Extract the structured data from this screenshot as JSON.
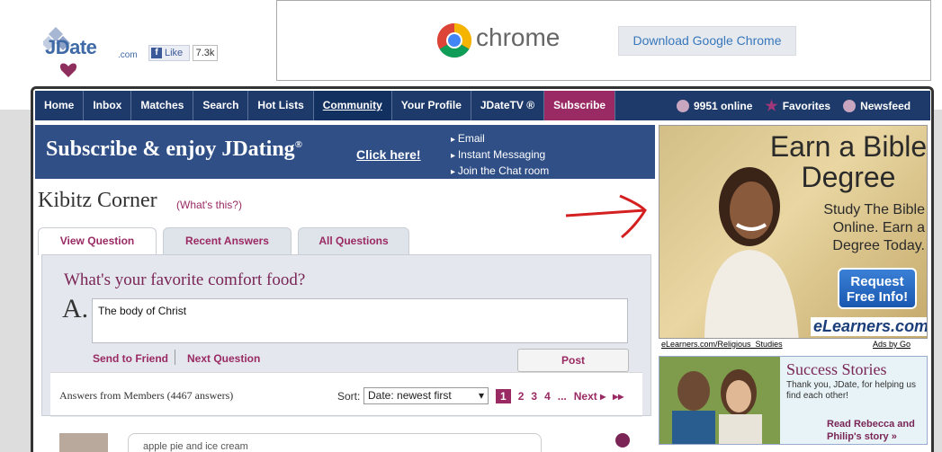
{
  "header": {
    "logo_text": "JDate",
    "logo_suffix": ".com",
    "fb_like_label": "Like",
    "fb_like_count": "7.3k"
  },
  "chrome_ad": {
    "word": "chrome",
    "button_label": "Download Google Chrome"
  },
  "nav": {
    "items": [
      {
        "label": "Home"
      },
      {
        "label": "Inbox"
      },
      {
        "label": "Matches"
      },
      {
        "label": "Search"
      },
      {
        "label": "Hot Lists"
      },
      {
        "label": "Community"
      },
      {
        "label": "Your Profile"
      },
      {
        "label": "JDateTV ®"
      },
      {
        "label": "Subscribe"
      }
    ],
    "online": "9951 online",
    "favorites": "Favorites",
    "newsfeed": "Newsfeed"
  },
  "subscribe_banner": {
    "headline": "Subscribe & enjoy JDating",
    "reg": "®",
    "click_here": "Click here!",
    "features": [
      "Email",
      "Instant Messaging",
      "Join the Chat room"
    ]
  },
  "kibitz": {
    "title": "Kibitz Corner",
    "whats_this": "(What's this?)",
    "tabs": [
      {
        "label": "View Question"
      },
      {
        "label": "Recent Answers"
      },
      {
        "label": "All Questions"
      }
    ],
    "question": "What's your favorite comfort food?",
    "answer_label": "A.",
    "answer_value": "The body of Christ",
    "send_to_friend": "Send to Friend",
    "next_question": "Next Question",
    "post_label": "Post",
    "answers_count": "Answers from Members (4467 answers)",
    "sort_label": "Sort:",
    "sort_value": "Date: newest first",
    "pages": [
      "1",
      "2",
      "3",
      "4"
    ],
    "ellipsis": "...",
    "next_label": "Next ▸",
    "last_label": "▸▸",
    "first_answer_preview": "apple pie and ice cream"
  },
  "right_ads": {
    "bible_title": "Earn a Bible Degree",
    "bible_sub": "Study The Bible Online. Earn a Degree Today.",
    "request_btn": "Request Free Info!",
    "elearners": "eLearners.com",
    "ad_url": "eLearners.com/Religious_Studies",
    "ads_by": "Ads by Go",
    "success_title": "Success Stories",
    "success_text": "Thank you, JDate, for helping us find each other!",
    "success_link": "Read Rebecca and Philip's story »"
  },
  "colors": {
    "nav_bg": "#1d3a6a",
    "accent": "#9a2a63",
    "banner_bg": "#2f4f86"
  }
}
